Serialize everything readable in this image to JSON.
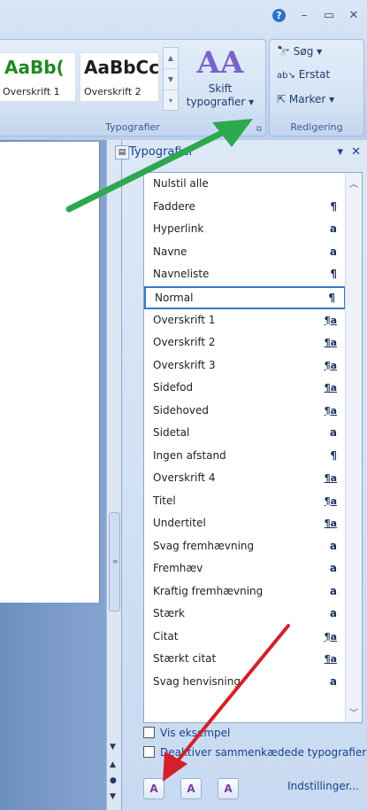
{
  "window": {
    "help_label": "?",
    "minimize_label": "–",
    "restore_label": "▭",
    "close_label": "✕"
  },
  "ribbon": {
    "styles_group": {
      "label": "Typografier",
      "samples": [
        {
          "sample": "AaBb(",
          "name": "Overskrift 1",
          "color": "#1f8a1f"
        },
        {
          "sample": "AaBbCc",
          "name": "Overskrift 2",
          "color": "#1e1e1e"
        }
      ],
      "change_styles": {
        "line1": "Skift",
        "line2": "typografier ▾",
        "icon": "AA"
      }
    },
    "editing_group": {
      "label": "Redigering",
      "find": "Søg ▾",
      "replace": "Erstat",
      "select": "Marker ▾"
    }
  },
  "pane": {
    "title": "Typografier",
    "menu_label": "▾",
    "close_label": "✕",
    "styles": [
      {
        "name": "Nulstil alle",
        "mark": ""
      },
      {
        "name": "Faddere",
        "mark": "¶"
      },
      {
        "name": "Hyperlink",
        "mark": "a"
      },
      {
        "name": "Navne",
        "mark": "a"
      },
      {
        "name": "Navneliste",
        "mark": "¶"
      },
      {
        "name": "Normal",
        "mark": "¶",
        "selected": true
      },
      {
        "name": "Overskrift 1",
        "mark": "¶a"
      },
      {
        "name": "Overskrift 2",
        "mark": "¶a"
      },
      {
        "name": "Overskrift 3",
        "mark": "¶a"
      },
      {
        "name": "Sidefod",
        "mark": "¶a"
      },
      {
        "name": "Sidehoved",
        "mark": "¶a"
      },
      {
        "name": "Sidetal",
        "mark": "a"
      },
      {
        "name": "Ingen afstand",
        "mark": "¶"
      },
      {
        "name": "Overskrift 4",
        "mark": "¶a"
      },
      {
        "name": "Titel",
        "mark": "¶a"
      },
      {
        "name": "Undertitel",
        "mark": "¶a"
      },
      {
        "name": "Svag fremhævning",
        "mark": "a"
      },
      {
        "name": "Fremhæv",
        "mark": "a"
      },
      {
        "name": "Kraftig fremhævning",
        "mark": "a"
      },
      {
        "name": "Stærk",
        "mark": "a"
      },
      {
        "name": "Citat",
        "mark": "¶a"
      },
      {
        "name": "Stærkt citat",
        "mark": "¶a"
      },
      {
        "name": "Svag henvisning",
        "mark": "a"
      }
    ],
    "show_preview": "Vis eksempel",
    "disable_linked": "Deaktiver sammenkædede typografier",
    "buttons": {
      "new_style": "A",
      "inspector": "A",
      "manage": "A"
    },
    "options": "Indstillinger..."
  },
  "colors": {
    "arrow_green": "#2ea84e",
    "arrow_red": "#d4202a",
    "selection": "#3b79c4"
  }
}
